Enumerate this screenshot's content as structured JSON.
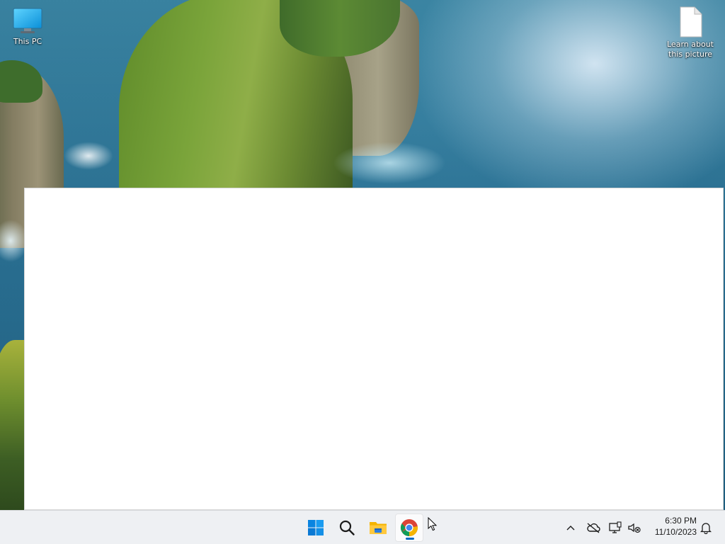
{
  "desktop": {
    "icons": [
      {
        "label": "This PC",
        "icon": "monitor-icon"
      },
      {
        "label": "Learn about\nthis picture",
        "icon": "document-icon"
      }
    ]
  },
  "window": {
    "state": "blank-white-window"
  },
  "taskbar": {
    "pinned": [
      {
        "name": "Start",
        "icon": "windows-logo-icon"
      },
      {
        "name": "Search",
        "icon": "search-icon"
      },
      {
        "name": "File Explorer",
        "icon": "folder-icon"
      },
      {
        "name": "Google Chrome",
        "icon": "chrome-icon",
        "running": true,
        "active": true
      }
    ],
    "tray": {
      "icons": [
        "chevron-up-icon",
        "onedrive-offline-icon",
        "network-icon",
        "volume-muted-icon",
        "notification-bell-icon"
      ],
      "time": "6:30 PM",
      "date": "11/10/2023"
    },
    "colors": {
      "background": "#eef0f3",
      "accent": "#0067c0"
    }
  }
}
